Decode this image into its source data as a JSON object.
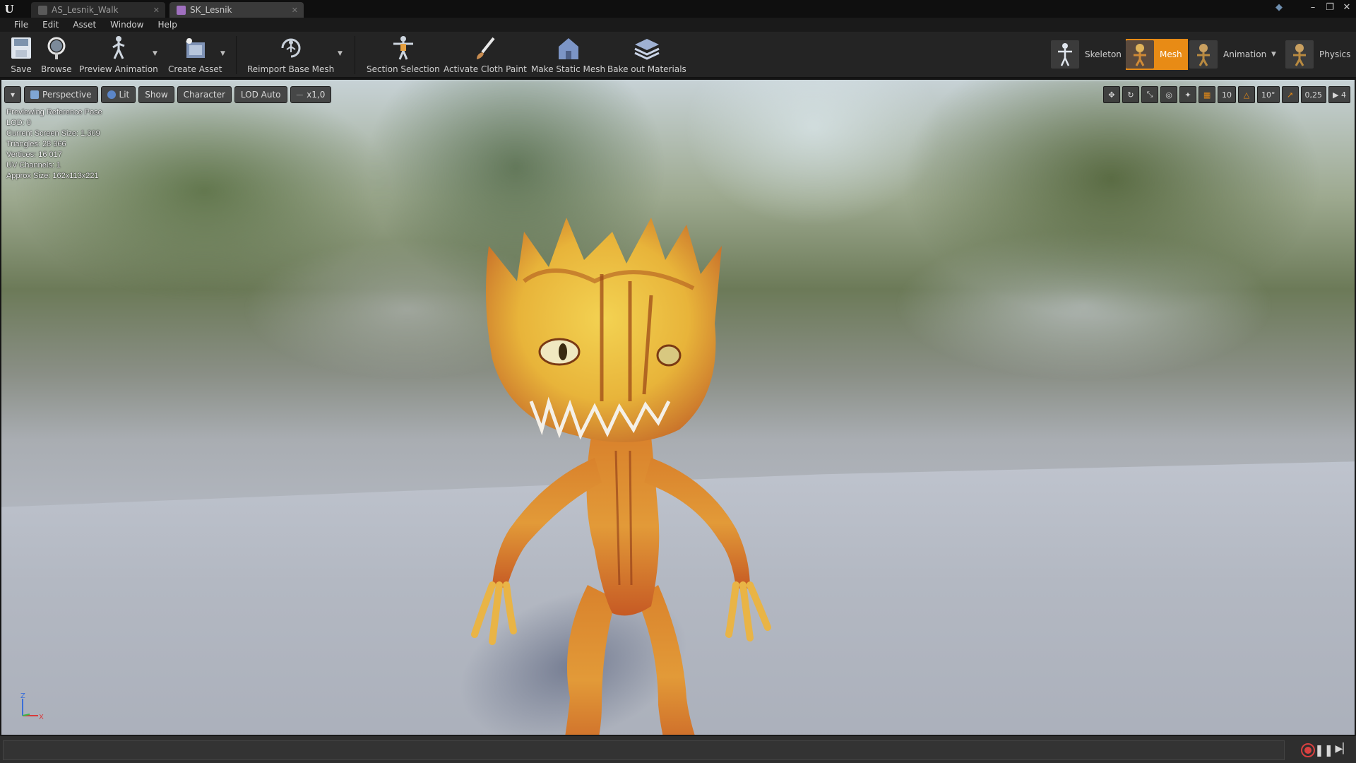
{
  "tabs": [
    {
      "label": "AS_Lesnik_Walk",
      "active": false,
      "icon": "animation-sequence-icon"
    },
    {
      "label": "SK_Lesnik",
      "active": true,
      "icon": "skeletal-mesh-icon"
    }
  ],
  "menu": [
    "File",
    "Edit",
    "Asset",
    "Window",
    "Help"
  ],
  "toolbar": {
    "save": "Save",
    "browse": "Browse",
    "preview_animation": "Preview Animation",
    "create_asset": "Create Asset",
    "reimport_base_mesh": "Reimport Base Mesh",
    "section_selection": "Section Selection",
    "activate_cloth_paint": "Activate Cloth Paint",
    "make_static_mesh": "Make Static Mesh",
    "bake_out_materials": "Bake out Materials"
  },
  "modes": {
    "skeleton": "Skeleton",
    "mesh": "Mesh",
    "animation": "Animation",
    "physics": "Physics",
    "active": "Mesh"
  },
  "viewport_toolbar": {
    "view_mode": "Perspective",
    "lighting": "Lit",
    "show": "Show",
    "character": "Character",
    "lod": "LOD Auto",
    "speed": "x1,0"
  },
  "viewport_right": {
    "grid_snap": "10",
    "rotation_snap": "10°",
    "scale_snap": "0,25",
    "camera_speed": "4"
  },
  "stats": [
    "Previewing Reference Pose",
    "LOD: 0",
    "Current Screen Size: 1,309",
    "Triangles: 28 366",
    "Vertices: 16 017",
    "UV Channels: 1",
    "Approx Size: 162x113x221"
  ],
  "axis": {
    "z": "Z",
    "x": "X"
  },
  "colors": {
    "accent": "#e88b15",
    "record": "#d84040"
  }
}
